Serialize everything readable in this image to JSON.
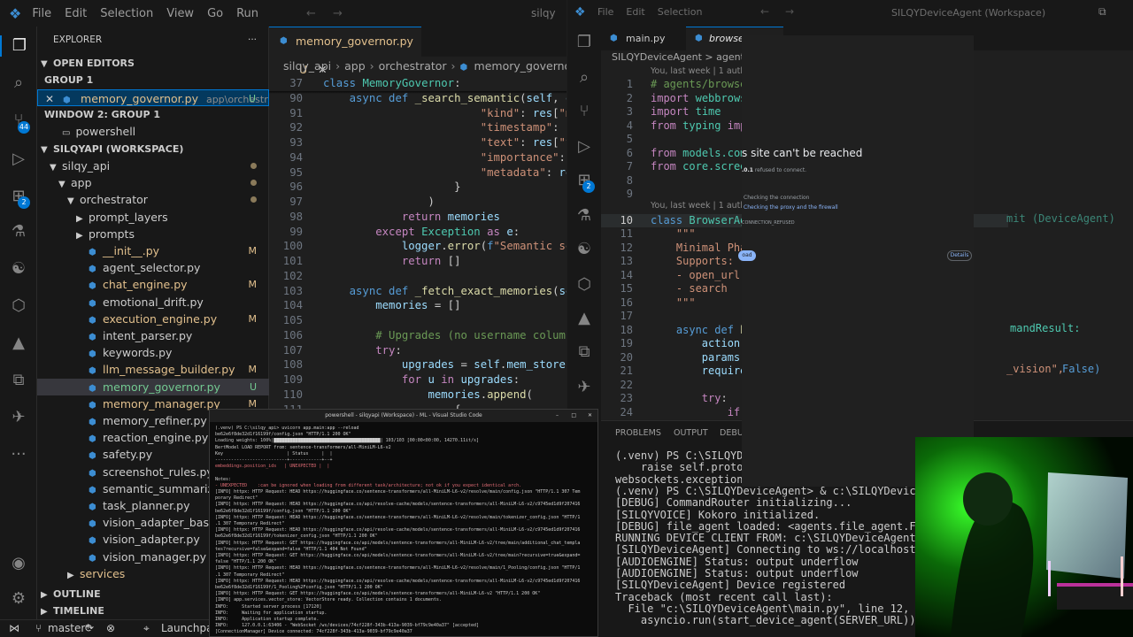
{
  "win1": {
    "menu": [
      "File",
      "Edit",
      "Selection",
      "View",
      "Go",
      "Run"
    ],
    "search_text": "silqy",
    "explorer_title": "EXPLORER",
    "open_editors": "OPEN EDITORS",
    "group1": "GROUP 1",
    "open_file": "memory_governor.py",
    "open_file_path": "app\\orchestrator",
    "open_file_status": "U",
    "window2_group": "WINDOW 2: GROUP 1",
    "powershell": "powershell",
    "workspace": "SILQYAPI (WORKSPACE)",
    "tree": [
      {
        "label": "silqy_api",
        "indent": 1,
        "type": "folder",
        "status": "dot"
      },
      {
        "label": "app",
        "indent": 2,
        "type": "folder",
        "status": "dot"
      },
      {
        "label": "orchestrator",
        "indent": 3,
        "type": "folder",
        "status": "dot"
      },
      {
        "label": "prompt_layers",
        "indent": 4,
        "type": "folder-closed",
        "status": ""
      },
      {
        "label": "prompts",
        "indent": 4,
        "type": "folder-closed",
        "status": ""
      },
      {
        "label": "__init__.py",
        "indent": 4,
        "type": "py",
        "status": "M"
      },
      {
        "label": "agent_selector.py",
        "indent": 4,
        "type": "py-plain",
        "status": ""
      },
      {
        "label": "chat_engine.py",
        "indent": 4,
        "type": "py",
        "status": "M"
      },
      {
        "label": "emotional_drift.py",
        "indent": 4,
        "type": "py-plain",
        "status": ""
      },
      {
        "label": "execution_engine.py",
        "indent": 4,
        "type": "py",
        "status": "M"
      },
      {
        "label": "intent_parser.py",
        "indent": 4,
        "type": "py-plain",
        "status": ""
      },
      {
        "label": "keywords.py",
        "indent": 4,
        "type": "py-plain",
        "status": ""
      },
      {
        "label": "llm_message_builder.py",
        "indent": 4,
        "type": "py",
        "status": "M"
      },
      {
        "label": "memory_governor.py",
        "indent": 4,
        "type": "py-sel",
        "status": "U"
      },
      {
        "label": "memory_manager.py",
        "indent": 4,
        "type": "py",
        "status": "M"
      },
      {
        "label": "memory_refiner.py",
        "indent": 4,
        "type": "py-plain",
        "status": ""
      },
      {
        "label": "reaction_engine.py",
        "indent": 4,
        "type": "py-plain",
        "status": ""
      },
      {
        "label": "safety.py",
        "indent": 4,
        "type": "py-plain",
        "status": ""
      },
      {
        "label": "screenshot_rules.py",
        "indent": 4,
        "type": "py-plain",
        "status": ""
      },
      {
        "label": "semantic_summarizer.py",
        "indent": 4,
        "type": "py-plain",
        "status": ""
      },
      {
        "label": "task_planner.py",
        "indent": 4,
        "type": "py-plain",
        "status": ""
      },
      {
        "label": "vision_adapter_base.py",
        "indent": 4,
        "type": "py-plain",
        "status": ""
      },
      {
        "label": "vision_adapter.py",
        "indent": 4,
        "type": "py-plain",
        "status": ""
      },
      {
        "label": "vision_manager.py",
        "indent": 4,
        "type": "py-plain",
        "status": ""
      },
      {
        "label": "services",
        "indent": 3,
        "type": "folder-closed-y",
        "status": ""
      }
    ],
    "outline": "OUTLINE",
    "timeline": "TIMELINE",
    "tab_label": "memory_governor.py",
    "tab_status": "U",
    "breadcrumb": [
      "silqy_api",
      "app",
      "orchestrator",
      "memory_governor.py"
    ],
    "code": [
      {
        "n": "37",
        "html": "<span class='kw'>class</span> <span class='cls'>MemoryGovernor</span>:"
      },
      {
        "n": "90",
        "html": "    <span class='kw'>async def</span> <span class='fn'>_search_semantic</span>(<span class='var'>self</span>, <span class='var'>quer</span>"
      },
      {
        "n": "91",
        "html": "                        <span class='str'>\"kind\"</span>: <span class='var'>res</span>[<span class='str'>\"meta</span>"
      },
      {
        "n": "92",
        "html": "                        <span class='str'>\"timestamp\"</span>: <span class='var'>res</span>["
      },
      {
        "n": "93",
        "html": "                        <span class='str'>\"text\"</span>: <span class='var'>res</span>[<span class='str'>\"text</span>"
      },
      {
        "n": "94",
        "html": "                        <span class='str'>\"importance\"</span>: <span class='num'>0.7</span>"
      },
      {
        "n": "95",
        "html": "                        <span class='str'>\"metadata\"</span>: <span class='var'>res</span>[<span class='str'>\"</span>"
      },
      {
        "n": "96",
        "html": "                    }"
      },
      {
        "n": "97",
        "html": "                )"
      },
      {
        "n": "98",
        "html": "            <span class='kw2'>return</span> <span class='var'>memories</span>"
      },
      {
        "n": "99",
        "html": "        <span class='kw2'>except</span> <span class='cls'>Exception</span> <span class='kw2'>as</span> <span class='var'>e</span>:"
      },
      {
        "n": "100",
        "html": "            <span class='var'>logger</span>.<span class='fn'>error</span>(<span class='kw'>f</span><span class='str'>\"Semantic searc</span>"
      },
      {
        "n": "101",
        "html": "            <span class='kw2'>return</span> []"
      },
      {
        "n": "102",
        "html": ""
      },
      {
        "n": "103",
        "html": "    <span class='kw'>async def</span> <span class='fn'>_fetch_exact_memories</span>(<span class='var'>self</span>,"
      },
      {
        "n": "104",
        "html": "        <span class='var'>memories</span> = []"
      },
      {
        "n": "105",
        "html": ""
      },
      {
        "n": "106",
        "html": "        <span class='cm'># Upgrades (no username column ye</span>"
      },
      {
        "n": "107",
        "html": "        <span class='kw2'>try</span>:"
      },
      {
        "n": "108",
        "html": "            <span class='var'>upgrades</span> = <span class='var'>self</span>.<span class='var'>mem_store</span>.<span class='fn'>get</span>"
      },
      {
        "n": "109",
        "html": "            <span class='kw2'>for</span> <span class='var'>u</span> <span class='kw2'>in</span> <span class='var'>upgrades</span>:"
      },
      {
        "n": "110",
        "html": "                <span class='var'>memories</span>.<span class='fn'>append</span>("
      },
      {
        "n": "111",
        "html": "                    {"
      }
    ],
    "status_branch": "master*",
    "status_launchpad": "Launchpad"
  },
  "win2": {
    "menu": [
      "File",
      "Edit",
      "Selection"
    ],
    "search_text": "SILQYDeviceAgent (Workspace)",
    "tab1": "main.py",
    "tab2": "browser",
    "breadcrumb": "SILQYDeviceAgent > agents >",
    "blame1": "You, last week | 1 author",
    "blame2": "You, last week | 1 author",
    "code": [
      {
        "n": "1",
        "html": "<span class='cm'># agents/browser_</span>"
      },
      {
        "n": "2",
        "html": "<span class='kw2'>import</span> <span class='cls'>webbrowser</span>"
      },
      {
        "n": "3",
        "html": "<span class='kw2'>import</span> <span class='cls'>time</span>"
      },
      {
        "n": "4",
        "html": "<span class='kw2'>from</span> <span class='cls'>typing</span> <span class='kw2'>impor</span>"
      },
      {
        "n": "5",
        "html": ""
      },
      {
        "n": "6",
        "html": "<span class='kw2'>from</span> <span class='cls'>models.comm</span>"
      },
      {
        "n": "7",
        "html": "<span class='kw2'>from</span> <span class='cls'>core.screen</span>"
      },
      {
        "n": "8",
        "html": ""
      },
      {
        "n": "9",
        "html": ""
      },
      {
        "n": "10",
        "html": "<span class='kw'>class</span> <span class='cls'>BrowserAgen</span>"
      },
      {
        "n": "11",
        "html": "    <span class='str'>\"\"\"</span>"
      },
      {
        "n": "12",
        "html": "    <span class='str'>Minimal Phase</span>"
      },
      {
        "n": "13",
        "html": "    <span class='str'>Supports:</span>"
      },
      {
        "n": "14",
        "html": "    <span class='str'>- open_url</span>"
      },
      {
        "n": "15",
        "html": "    <span class='str'>- search</span>"
      },
      {
        "n": "16",
        "html": "    <span class='str'>\"\"\"</span>"
      },
      {
        "n": "17",
        "html": ""
      },
      {
        "n": "18",
        "html": "    <span class='kw'>async def</span> <span class='fn'>ha</span>"
      },
      {
        "n": "19",
        "html": "        <span class='var'>action</span> ="
      },
      {
        "n": "20",
        "html": "        <span class='var'>params</span>: D"
      },
      {
        "n": "21",
        "html": "        <span class='var'>requires</span>_"
      },
      {
        "n": "22",
        "html": ""
      },
      {
        "n": "23",
        "html": "        <span class='kw2'>try</span>:"
      },
      {
        "n": "24",
        "html": "            <span class='kw2'>if</span> <span class='var'>ac</span>"
      }
    ],
    "right_fragments": {
      "line10": "mit (DeviceAgent)",
      "line18": "mandResult:",
      "line21a": "_vision\",",
      "line21b": "False)"
    },
    "overlay": {
      "title": "s site can't be reached",
      "addr": ".0.1",
      "addr_rest": "refused to connect.",
      "try": "Checking the connection",
      "proxy": "Checking the proxy and the firewall",
      "code": "CONNECTION_REFUSED",
      "reload": "oad",
      "details": "Details"
    },
    "panel_tabs": [
      "PROBLEMS",
      "OUTPUT",
      "DEBUG"
    ],
    "terminal": [
      "(.venv) PS C:\\SILQYDeviceAgent>",
      "    raise self.protocol.",
      "websockets.exceptions.Co",
      "(.venv) PS C:\\SILQYDeviceAgent> & c:\\SILQYDeviceAgent\\.ve",
      "[DEBUG] CommandRouter initializing...",
      "[SILQYVOICE] Kokoro initialized.",
      "[DEBUG] file_agent loaded: <agents.file_agent.FileAgent c",
      "RUNNING DEVICE CLIENT FROM: c:\\SILQYDeviceAgent\\core\\devi",
      "[SILQYDeviceAgent] Connecting to ws://localhost:8000 as 7",
      "[AUDIOENGINE] Status: output underflow",
      "[AUDIOENGINE] Status: output underflow",
      "[SILQYDeviceAgent] Device registered",
      "Traceback (most recent call last):",
      "  File \"c:\\SILQYDeviceAgent\\main.py\", line 12, in <module",
      "    asyncio.run(start_device_agent(SERVER_URL))"
    ]
  },
  "popup": {
    "title": "powershell - silqyapi (Workspace) - ML - Visual Studio Code",
    "lines": [
      "(.venv) PS C:\\silqy_api> uvicorn app.main:app --reload",
      "be62e6f8de32d1f16199f/config.json \"HTTP/1.1 200 OK\"",
      "Loading weights: 100%|████████████████████████████████████████| 103/103 [00:00<00:00, 14270.11it/s]",
      "BertModel LOAD REPORT from: sentence-transformers/all-MiniLM-L6-v2",
      "Key                        | Status     |  |",
      "---------------------------+------------+--+",
      "embeddings.position_ids   | UNEXPECTED |  |",
      "",
      "Notes:",
      "- UNEXPECTED    :can be ignored when loading from different task/architecture; not ok if you expect identical arch.",
      "[INFO] httpx: HTTP Request: HEAD https://huggingface.co/sentence-transformers/all-MiniLM-L6-v2/resolve/main/config.json \"HTTP/1.1 307 Tem",
      "porary Redirect\"",
      "[INFO] httpx: HTTP Request: HEAD https://huggingface.co/api/resolve-cache/models/sentence-transformers/all-MiniLM-L6-v2/c9745ed1d9f207416",
      "be62e6f8de32d1f16199f/config.json \"HTTP/1.1 200 OK\"",
      "[INFO] httpx: HTTP Request: HEAD https://huggingface.co/sentence-transformers/all-MiniLM-L6-v2/resolve/main/tokenizer_config.json \"HTTP/1",
      ".1 307 Temporary Redirect\"",
      "[INFO] httpx: HTTP Request: HEAD https://huggingface.co/api/resolve-cache/models/sentence-transformers/all-MiniLM-L6-v2/c9745ed1d9f207416",
      "be62e6f8de32d1f16199f/tokenizer_config.json \"HTTP/1.1 200 OK\"",
      "[INFO] httpx: HTTP Request: GET https://huggingface.co/api/models/sentence-transformers/all-MiniLM-L6-v2/tree/main/additional_chat_templa",
      "tes?recursive=false&expand=false \"HTTP/1.1 404 Not Found\"",
      "[INFO] httpx: HTTP Request: GET https://huggingface.co/api/models/sentence-transformers/all-MiniLM-L6-v2/tree/main?recursive=true&expand=",
      "false \"HTTP/1.1 200 OK\"",
      "[INFO] httpx: HTTP Request: HEAD https://huggingface.co/sentence-transformers/all-MiniLM-L6-v2/resolve/main/1_Pooling/config.json \"HTTP/1",
      ".1 307 Temporary Redirect\"",
      "[INFO] httpx: HTTP Request: HEAD https://huggingface.co/api/resolve-cache/models/sentence-transformers/all-MiniLM-L6-v2/c9745ed1d9f207416",
      "be62e6f8de32d1f16199f/1_Pooling%2Fconfig.json \"HTTP/1.1 200 OK\"",
      "[INFO] httpx: HTTP Request: GET https://huggingface.co/api/models/sentence-transformers/all-MiniLM-L6-v2 \"HTTP/1.1 200 OK\"",
      "[INFO] app.services.vector_store: VectorStore ready. Collection contains 1 documents.",
      "INFO:     Started server process [17120]",
      "INFO:     Waiting for application startup.",
      "INFO:     Application startup complete.",
      "INFO:     127.0.0.1:63406 - \"WebSocket /ws/devices/74cf228f-343b-413a-9039-bf79c9e40a37\" [accepted]",
      "[ConnectionManager] Device connected: 74cf228f-343b-413a-9039-bf79c9e40a37"
    ]
  },
  "badges": {
    "source_control": "44",
    "extensions": "2",
    "extensions2": "2"
  },
  "colors": {
    "accent": "#0078d4",
    "modified": "#e2c08d",
    "untracked": "#73c991"
  }
}
